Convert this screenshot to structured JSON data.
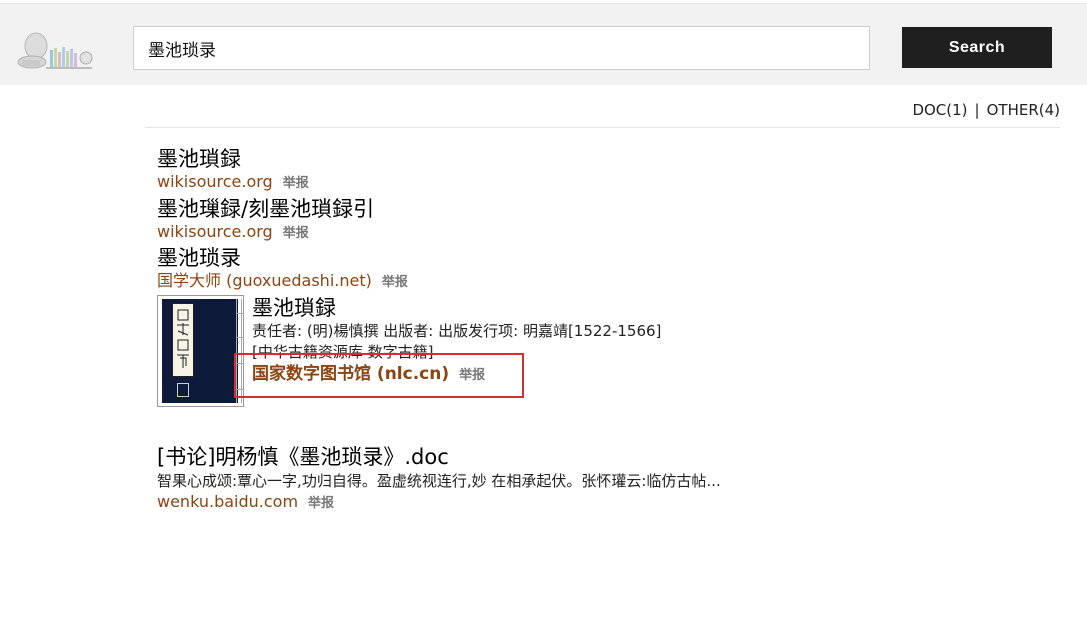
{
  "header": {
    "logo_alt": "logo",
    "search_value": "墨池琐录",
    "search_button": "Search"
  },
  "filters": {
    "doc": "DOC(1)",
    "separator": "|",
    "other": "OTHER(4)"
  },
  "results": [
    {
      "title": "墨池瑣録",
      "source": "wikisource.org",
      "report": "举报"
    },
    {
      "title": "墨池璅録/刻墨池瑣録引",
      "source": "wikisource.org",
      "report": "举报"
    },
    {
      "title": "墨池琐录",
      "source": "国学大师 (guoxuedashi.net)",
      "report": "举报"
    }
  ],
  "rich_result": {
    "cover_label": "国家图书馆",
    "title": "墨池瑣録",
    "desc_line1": "责任者: (明)楊慎撰 出版者: 出版发行项: 明嘉靖[1522-1566]",
    "desc_line2": "[中华古籍资源库 数字古籍]",
    "source": "国家数字图书馆 (nlc.cn)",
    "report": "举报"
  },
  "doc_result": {
    "title": "[书论]明杨慎《墨池琐录》.doc",
    "snippet": "智果心成颂:覃心一字,功归自得。盈虚统视连行,妙 在相承起伏。张怀瓘云:临仿古帖...",
    "source": "wenku.baidu.com",
    "report": "举报"
  },
  "colors": {
    "source_link": "#8b4513",
    "highlight_box": "#d03030",
    "search_button_bg": "#1f1f1f"
  }
}
